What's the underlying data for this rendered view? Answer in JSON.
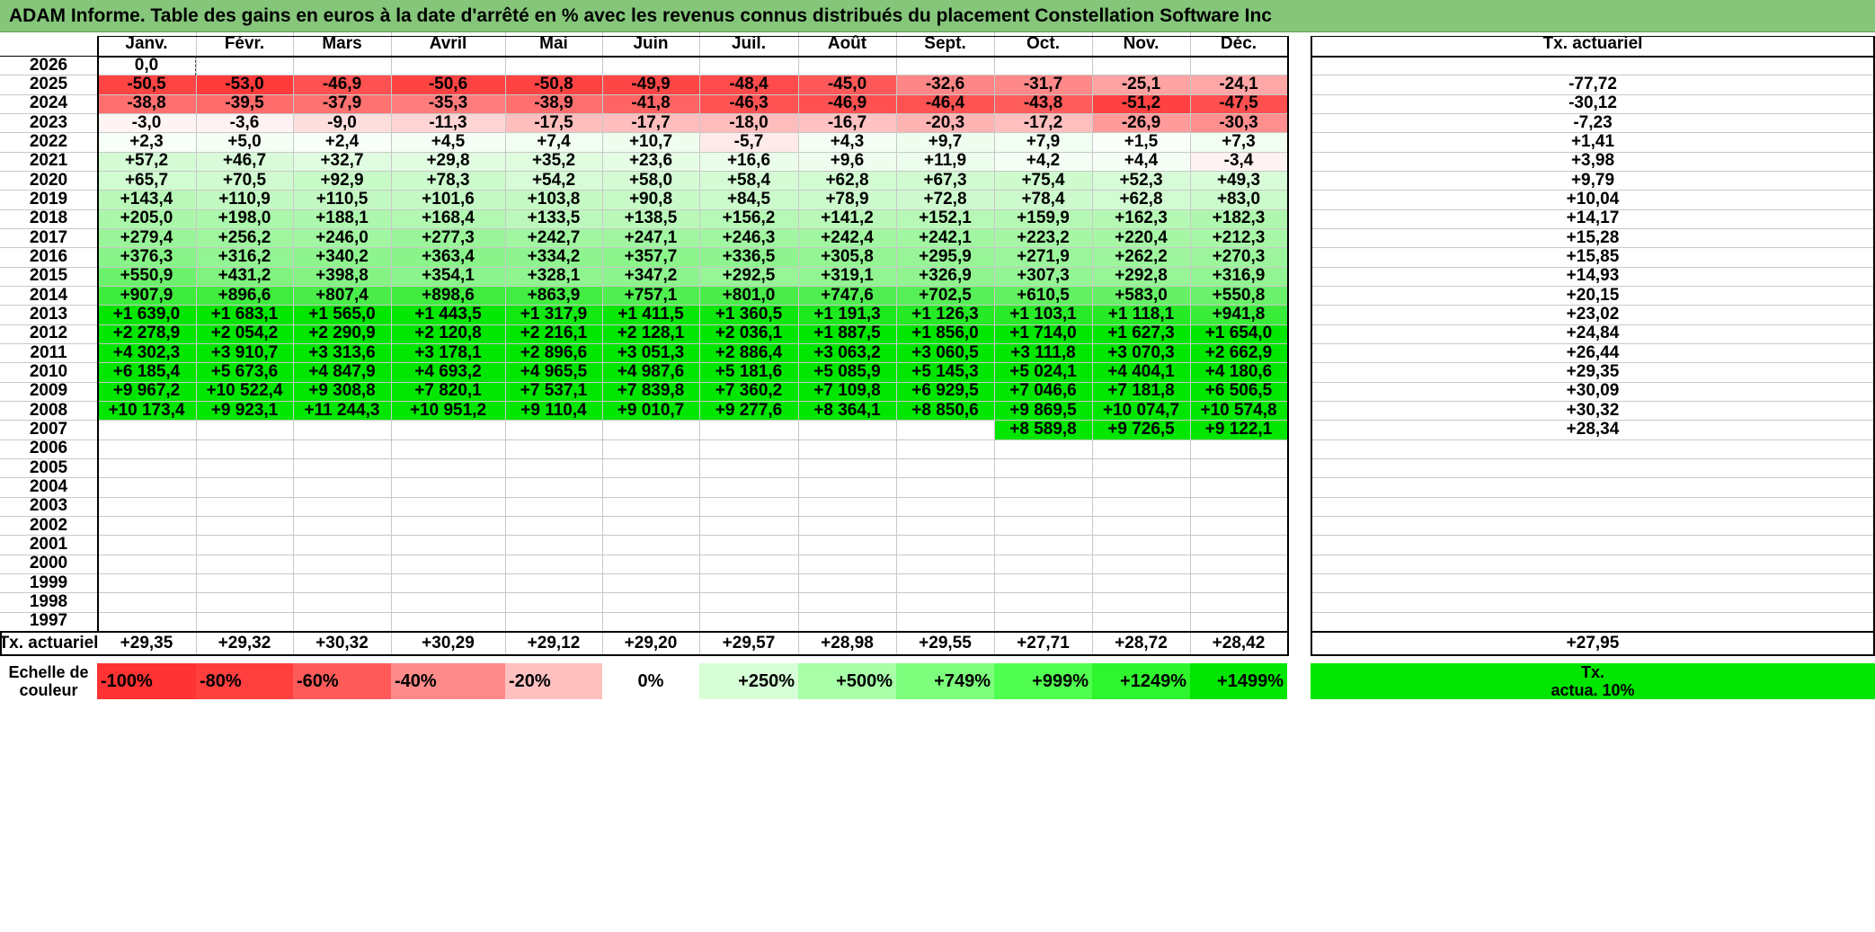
{
  "title": "ADAM Informe. Table des gains en euros à la date d'arrêté en % avec les revenus connus distribués du placement Constellation Software Inc",
  "months": [
    "Janv.",
    "Févr.",
    "Mars",
    "Avril",
    "Mai",
    "Juin",
    "Juil.",
    "Août",
    "Sept.",
    "Oct.",
    "Nov.",
    "Déc."
  ],
  "rate_header": "Tx. actuariel",
  "rows": [
    {
      "year": "2026",
      "values": [
        "0,0",
        "",
        "",
        "",
        "",
        "",
        "",
        "",
        "",
        "",
        "",
        ""
      ],
      "rate": ""
    },
    {
      "year": "2025",
      "values": [
        "-50,5",
        "-53,0",
        "-46,9",
        "-50,6",
        "-50,8",
        "-49,9",
        "-48,4",
        "-45,0",
        "-32,6",
        "-31,7",
        "-25,1",
        "-24,1"
      ],
      "rate": "-77,72"
    },
    {
      "year": "2024",
      "values": [
        "-38,8",
        "-39,5",
        "-37,9",
        "-35,3",
        "-38,9",
        "-41,8",
        "-46,3",
        "-46,9",
        "-46,4",
        "-43,8",
        "-51,2",
        "-47,5"
      ],
      "rate": "-30,12"
    },
    {
      "year": "2023",
      "values": [
        "-3,0",
        "-3,6",
        "-9,0",
        "-11,3",
        "-17,5",
        "-17,7",
        "-18,0",
        "-16,7",
        "-20,3",
        "-17,2",
        "-26,9",
        "-30,3"
      ],
      "rate": "-7,23"
    },
    {
      "year": "2022",
      "values": [
        "+2,3",
        "+5,0",
        "+2,4",
        "+4,5",
        "+7,4",
        "+10,7",
        "-5,7",
        "+4,3",
        "+9,7",
        "+7,9",
        "+1,5",
        "+7,3"
      ],
      "rate": "+1,41"
    },
    {
      "year": "2021",
      "values": [
        "+57,2",
        "+46,7",
        "+32,7",
        "+29,8",
        "+35,2",
        "+23,6",
        "+16,6",
        "+9,6",
        "+11,9",
        "+4,2",
        "+4,4",
        "-3,4"
      ],
      "rate": "+3,98"
    },
    {
      "year": "2020",
      "values": [
        "+65,7",
        "+70,5",
        "+92,9",
        "+78,3",
        "+54,2",
        "+58,0",
        "+58,4",
        "+62,8",
        "+67,3",
        "+75,4",
        "+52,3",
        "+49,3"
      ],
      "rate": "+9,79"
    },
    {
      "year": "2019",
      "values": [
        "+143,4",
        "+110,9",
        "+110,5",
        "+101,6",
        "+103,8",
        "+90,8",
        "+84,5",
        "+78,9",
        "+72,8",
        "+78,4",
        "+62,8",
        "+83,0"
      ],
      "rate": "+10,04"
    },
    {
      "year": "2018",
      "values": [
        "+205,0",
        "+198,0",
        "+188,1",
        "+168,4",
        "+133,5",
        "+138,5",
        "+156,2",
        "+141,2",
        "+152,1",
        "+159,9",
        "+162,3",
        "+182,3"
      ],
      "rate": "+14,17"
    },
    {
      "year": "2017",
      "values": [
        "+279,4",
        "+256,2",
        "+246,0",
        "+277,3",
        "+242,7",
        "+247,1",
        "+246,3",
        "+242,4",
        "+242,1",
        "+223,2",
        "+220,4",
        "+212,3"
      ],
      "rate": "+15,28"
    },
    {
      "year": "2016",
      "values": [
        "+376,3",
        "+316,2",
        "+340,2",
        "+363,4",
        "+334,2",
        "+357,7",
        "+336,5",
        "+305,8",
        "+295,9",
        "+271,9",
        "+262,2",
        "+270,3"
      ],
      "rate": "+15,85"
    },
    {
      "year": "2015",
      "values": [
        "+550,9",
        "+431,2",
        "+398,8",
        "+354,1",
        "+328,1",
        "+347,2",
        "+292,5",
        "+319,1",
        "+326,9",
        "+307,3",
        "+292,8",
        "+316,9"
      ],
      "rate": "+14,93"
    },
    {
      "year": "2014",
      "values": [
        "+907,9",
        "+896,6",
        "+807,4",
        "+898,6",
        "+863,9",
        "+757,1",
        "+801,0",
        "+747,6",
        "+702,5",
        "+610,5",
        "+583,0",
        "+550,8"
      ],
      "rate": "+20,15"
    },
    {
      "year": "2013",
      "values": [
        "+1 639,0",
        "+1 683,1",
        "+1 565,0",
        "+1 443,5",
        "+1 317,9",
        "+1 411,5",
        "+1 360,5",
        "+1 191,3",
        "+1 126,3",
        "+1 103,1",
        "+1 118,1",
        "+941,8"
      ],
      "rate": "+23,02"
    },
    {
      "year": "2012",
      "values": [
        "+2 278,9",
        "+2 054,2",
        "+2 290,9",
        "+2 120,8",
        "+2 216,1",
        "+2 128,1",
        "+2 036,1",
        "+1 887,5",
        "+1 856,0",
        "+1 714,0",
        "+1 627,3",
        "+1 654,0"
      ],
      "rate": "+24,84"
    },
    {
      "year": "2011",
      "values": [
        "+4 302,3",
        "+3 910,7",
        "+3 313,6",
        "+3 178,1",
        "+2 896,6",
        "+3 051,3",
        "+2 886,4",
        "+3 063,2",
        "+3 060,5",
        "+3 111,8",
        "+3 070,3",
        "+2 662,9"
      ],
      "rate": "+26,44"
    },
    {
      "year": "2010",
      "values": [
        "+6 185,4",
        "+5 673,6",
        "+4 847,9",
        "+4 693,2",
        "+4 965,5",
        "+4 987,6",
        "+5 181,6",
        "+5 085,9",
        "+5 145,3",
        "+5 024,1",
        "+4 404,1",
        "+4 180,6"
      ],
      "rate": "+29,35"
    },
    {
      "year": "2009",
      "values": [
        "+9 967,2",
        "+10 522,4",
        "+9 308,8",
        "+7 820,1",
        "+7 537,1",
        "+7 839,8",
        "+7 360,2",
        "+7 109,8",
        "+6 929,5",
        "+7 046,6",
        "+7 181,8",
        "+6 506,5"
      ],
      "rate": "+30,09"
    },
    {
      "year": "2008",
      "values": [
        "+10 173,4",
        "+9 923,1",
        "+11 244,3",
        "+10 951,2",
        "+9 110,4",
        "+9 010,7",
        "+9 277,6",
        "+8 364,1",
        "+8 850,6",
        "+9 869,5",
        "+10 074,7",
        "+10 574,8"
      ],
      "rate": "+30,32"
    },
    {
      "year": "2007",
      "values": [
        "",
        "",
        "",
        "",
        "",
        "",
        "",
        "",
        "",
        "+8 589,8",
        "+9 726,5",
        "+9 122,1"
      ],
      "rate": "+28,34"
    },
    {
      "year": "2006",
      "values": [
        "",
        "",
        "",
        "",
        "",
        "",
        "",
        "",
        "",
        "",
        "",
        ""
      ],
      "rate": ""
    },
    {
      "year": "2005",
      "values": [
        "",
        "",
        "",
        "",
        "",
        "",
        "",
        "",
        "",
        "",
        "",
        ""
      ],
      "rate": ""
    },
    {
      "year": "2004",
      "values": [
        "",
        "",
        "",
        "",
        "",
        "",
        "",
        "",
        "",
        "",
        "",
        ""
      ],
      "rate": ""
    },
    {
      "year": "2003",
      "values": [
        "",
        "",
        "",
        "",
        "",
        "",
        "",
        "",
        "",
        "",
        "",
        ""
      ],
      "rate": ""
    },
    {
      "year": "2002",
      "values": [
        "",
        "",
        "",
        "",
        "",
        "",
        "",
        "",
        "",
        "",
        "",
        ""
      ],
      "rate": ""
    },
    {
      "year": "2001",
      "values": [
        "",
        "",
        "",
        "",
        "",
        "",
        "",
        "",
        "",
        "",
        "",
        ""
      ],
      "rate": ""
    },
    {
      "year": "2000",
      "values": [
        "",
        "",
        "",
        "",
        "",
        "",
        "",
        "",
        "",
        "",
        "",
        ""
      ],
      "rate": ""
    },
    {
      "year": "1999",
      "values": [
        "",
        "",
        "",
        "",
        "",
        "",
        "",
        "",
        "",
        "",
        "",
        ""
      ],
      "rate": ""
    },
    {
      "year": "1998",
      "values": [
        "",
        "",
        "",
        "",
        "",
        "",
        "",
        "",
        "",
        "",
        "",
        ""
      ],
      "rate": ""
    },
    {
      "year": "1997",
      "values": [
        "",
        "",
        "",
        "",
        "",
        "",
        "",
        "",
        "",
        "",
        "",
        ""
      ],
      "rate": ""
    }
  ],
  "footer": {
    "label": "Tx. actuariel",
    "values": [
      "+29,35",
      "+29,32",
      "+30,32",
      "+30,29",
      "+29,12",
      "+29,20",
      "+29,57",
      "+28,98",
      "+29,55",
      "+27,71",
      "+28,72",
      "+28,42"
    ],
    "rate": "+27,95"
  },
  "legend": {
    "label_line1": "Echelle de",
    "label_line2": "couleur",
    "items": [
      {
        "label": "-100%",
        "color": "#FF3333"
      },
      {
        "label": "-80%",
        "color": "#FF3E3E"
      },
      {
        "label": "-60%",
        "color": "#FF5A5A"
      },
      {
        "label": "-40%",
        "color": "#FF8A8A"
      },
      {
        "label": "-20%",
        "color": "#FFC0C0"
      },
      {
        "label": "0%",
        "color": "#FFFFFF"
      },
      {
        "label": "+250%",
        "color": "#D7FFD7"
      },
      {
        "label": "+500%",
        "color": "#A8FFA8"
      },
      {
        "label": "+749%",
        "color": "#7DFF7D"
      },
      {
        "label": "+999%",
        "color": "#50FF50"
      },
      {
        "label": "+1249%",
        "color": "#2EF52E"
      },
      {
        "label": "+1499%",
        "color": "#00E600"
      }
    ],
    "rate_line1": "Tx.",
    "rate_line2": "actua. 10%",
    "rate_color": "#00E600"
  },
  "colors": {
    "title_bar": "#85C67A",
    "negative_strong": "#FF3333",
    "positive_strong": "#00E600"
  }
}
